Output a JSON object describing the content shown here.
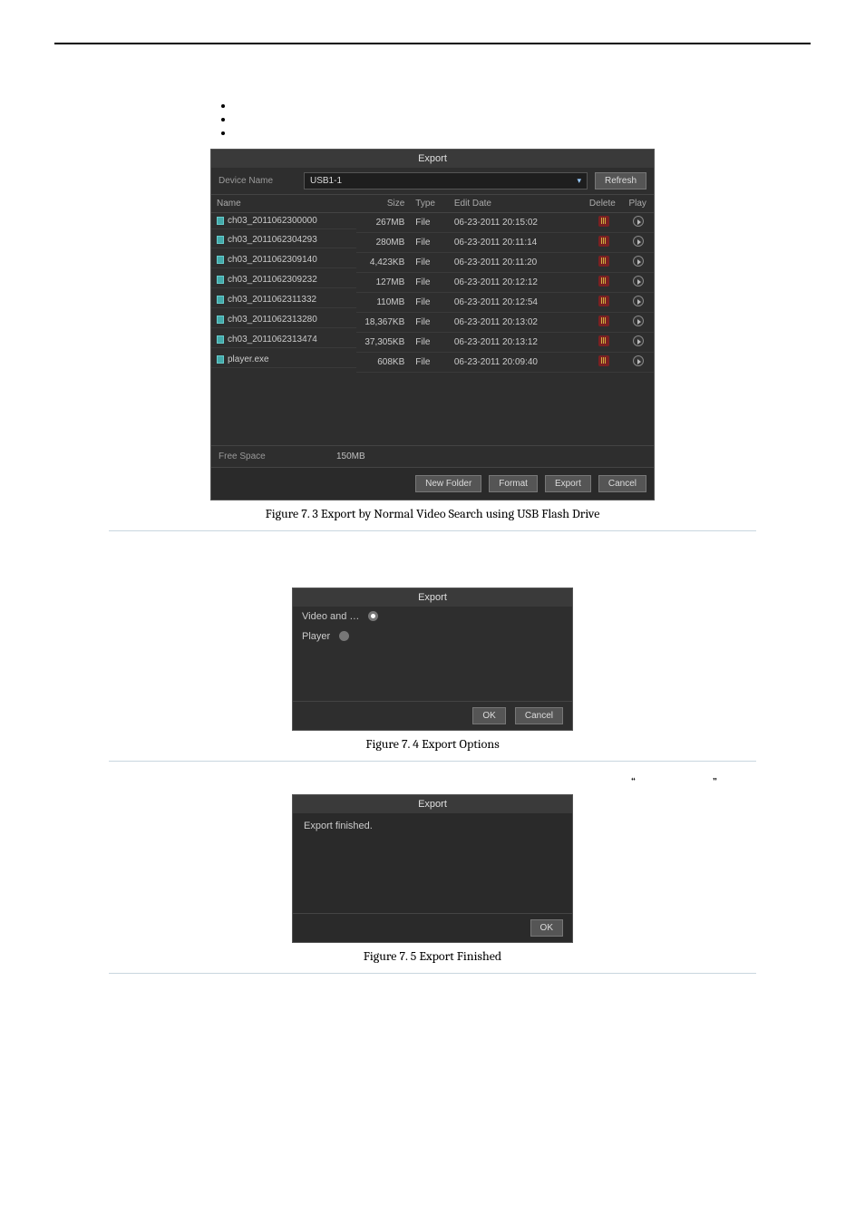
{
  "bulleted": {
    "items": [
      "",
      "",
      ""
    ]
  },
  "dlg1": {
    "title": "Export",
    "device_label": "Device Name",
    "device_value": "USB1-1",
    "refresh": "Refresh",
    "headers": {
      "name": "Name",
      "size": "Size",
      "type": "Type",
      "edit": "Edit Date",
      "delete": "Delete",
      "play": "Play"
    },
    "rows": [
      {
        "name": "ch03_2011062300000",
        "size": "267MB",
        "type": "File",
        "edit": "06-23-2011 20:15:02"
      },
      {
        "name": "ch03_2011062304293",
        "size": "280MB",
        "type": "File",
        "edit": "06-23-2011 20:11:14"
      },
      {
        "name": "ch03_2011062309140",
        "size": "4,423KB",
        "type": "File",
        "edit": "06-23-2011 20:11:20"
      },
      {
        "name": "ch03_2011062309232",
        "size": "127MB",
        "type": "File",
        "edit": "06-23-2011 20:12:12"
      },
      {
        "name": "ch03_2011062311332",
        "size": "110MB",
        "type": "File",
        "edit": "06-23-2011 20:12:54"
      },
      {
        "name": "ch03_2011062313280",
        "size": "18,367KB",
        "type": "File",
        "edit": "06-23-2011 20:13:02"
      },
      {
        "name": "ch03_2011062313474",
        "size": "37,305KB",
        "type": "File",
        "edit": "06-23-2011 20:13:12"
      },
      {
        "name": "player.exe",
        "size": "608KB",
        "type": "File",
        "edit": "06-23-2011 20:09:40"
      }
    ],
    "free_label": "Free Space",
    "free_value": "150MB",
    "btns": {
      "newfolder": "New Folder",
      "format": "Format",
      "export": "Export",
      "cancel": "Cancel"
    }
  },
  "caption1": "Figure 7. 3  Export by Normal Video Search using USB Flash Drive",
  "dlg2": {
    "title": "Export",
    "opt1": "Video and …",
    "opt2": "Player",
    "ok": "OK",
    "cancel": "Cancel"
  },
  "caption2": "Figure 7. 4  Export Options",
  "quotes": {
    "open": "“",
    "close": "”"
  },
  "dlg3": {
    "title": "Export",
    "msg": "Export finished.",
    "ok": "OK"
  },
  "caption3": "Figure 7. 5  Export Finished"
}
